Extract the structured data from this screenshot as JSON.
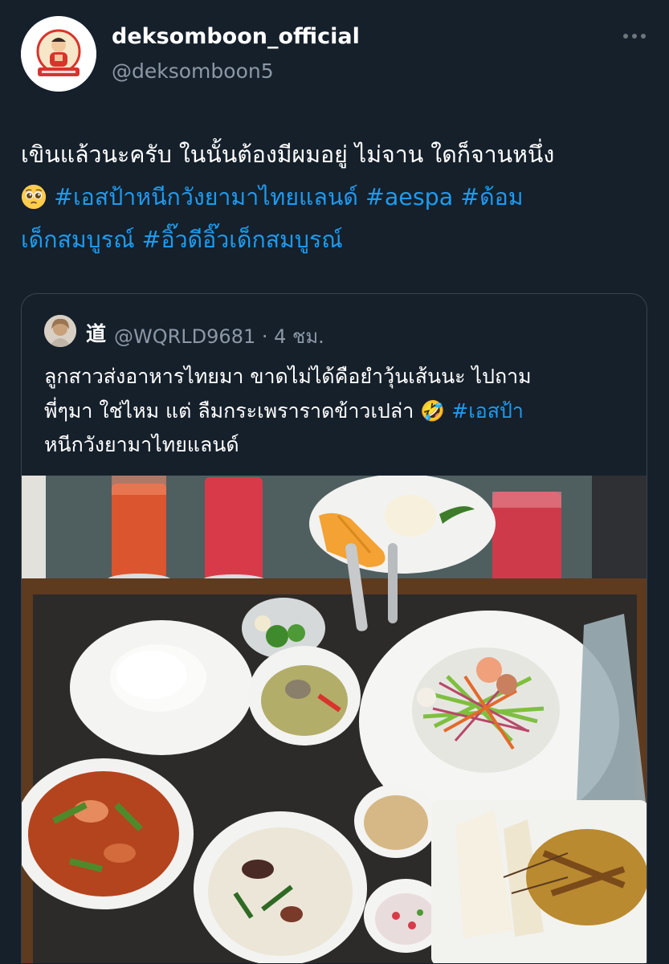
{
  "tweet": {
    "display_name": "deksomboon_official",
    "handle": "@deksomboon5",
    "avatar_text": "ตราเด็กสมบูรณ์",
    "text_line1": "เขินแล้วนะครับ ในนั้นต้องมีผมอยู่ ไม่จาน ใดก็จานหนึ่ง",
    "emoji": "pleading-face",
    "hashtag1": "#เอสป้าหนีกวังยามาไทยแลนด์",
    "hashtag2": "#aespa",
    "hashtag3": "#ด้อม",
    "hashtag3_cont": "เด็กสมบูรณ์",
    "hashtag4": "#อิ๊วดีอิ๊วเด็กสมบูรณ์"
  },
  "quote": {
    "name": "道",
    "handle": "@WQRLD9681",
    "separator": "·",
    "time": "4 ชม.",
    "text_line1": "ลูกสาวส่งอาหารไทยมา ขาดไม่ได้คือยำวุ้นเส้นนะ ไปถาม",
    "text_line2": "พี่ๆมา ใช่ไหม แต่ ลืมกระเพราราดข้าวเปล่า 🤣",
    "hashtag": "#เอสป้า",
    "text_line3": "หนีกวังยามาไทยแลนด์"
  },
  "icons": {
    "more": "more-horizontal-icon",
    "emoji": "pleading-face-icon"
  },
  "colors": {
    "background": "#15202b",
    "link": "#1d9bf0",
    "secondary_text": "#8b98a5",
    "border": "#38444d"
  }
}
